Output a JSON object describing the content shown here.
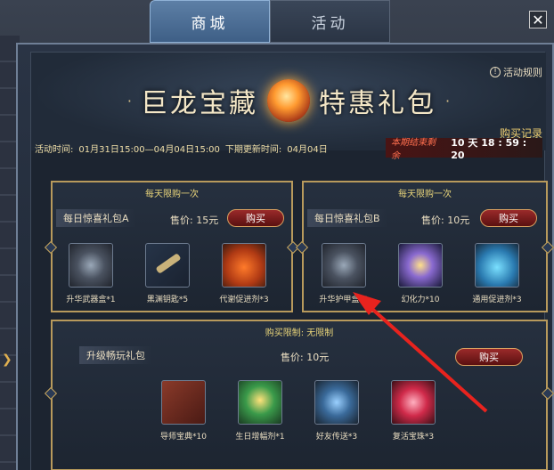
{
  "tabs": [
    {
      "label": "商城",
      "active": true
    },
    {
      "label": "活动",
      "active": false
    }
  ],
  "close_label": "✕",
  "banner": {
    "title_left": "巨龙宝藏",
    "title_right": "特惠礼包",
    "rule_link": "活动规则",
    "buy_record": "购买记录"
  },
  "timeline": {
    "activity_label": "活动时间:",
    "activity_value": "01月31日15:00—04月04日15:00",
    "next_update_label": "下期更新时间:",
    "next_update_value": "04月04日"
  },
  "countdown": {
    "label": "本期结束剩余",
    "value": "10 天 18 : 59 : 20"
  },
  "packs": [
    {
      "limit": "每天限购一次",
      "name": "每日惊喜礼包A",
      "price": "售价: 15元",
      "buy_label": "购买",
      "items": [
        {
          "label": "升华武器盒*1",
          "icon": "weapon-box-icon"
        },
        {
          "label": "黑渊钥匙*5",
          "icon": "key-icon"
        },
        {
          "label": "代谢促进剂*3",
          "icon": "potion-icon"
        }
      ]
    },
    {
      "limit": "每天限购一次",
      "name": "每日惊喜礼包B",
      "price": "售价: 10元",
      "buy_label": "购买",
      "items": [
        {
          "label": "升华护甲盒*1",
          "icon": "armor-box-icon"
        },
        {
          "label": "幻化力*10",
          "icon": "ring-icon"
        },
        {
          "label": "通用促进剂*3",
          "icon": "blue-potion-icon"
        }
      ]
    },
    {
      "limit": "购买限制: 无限制",
      "name": "升级畅玩礼包",
      "price": "售价: 10元",
      "buy_label": "购买",
      "items": [
        {
          "label": "导师宝典*10",
          "icon": "book-icon"
        },
        {
          "label": "生日增幅剂*1",
          "icon": "badge-icon"
        },
        {
          "label": "好友传送*3",
          "icon": "diamond-icon"
        },
        {
          "label": "复活宝珠*3",
          "icon": "orb-icon"
        }
      ]
    }
  ],
  "colors": {
    "gold": "#e8d47a",
    "buy_red": "#9a2a2a",
    "arrow_red": "#e8231e"
  }
}
